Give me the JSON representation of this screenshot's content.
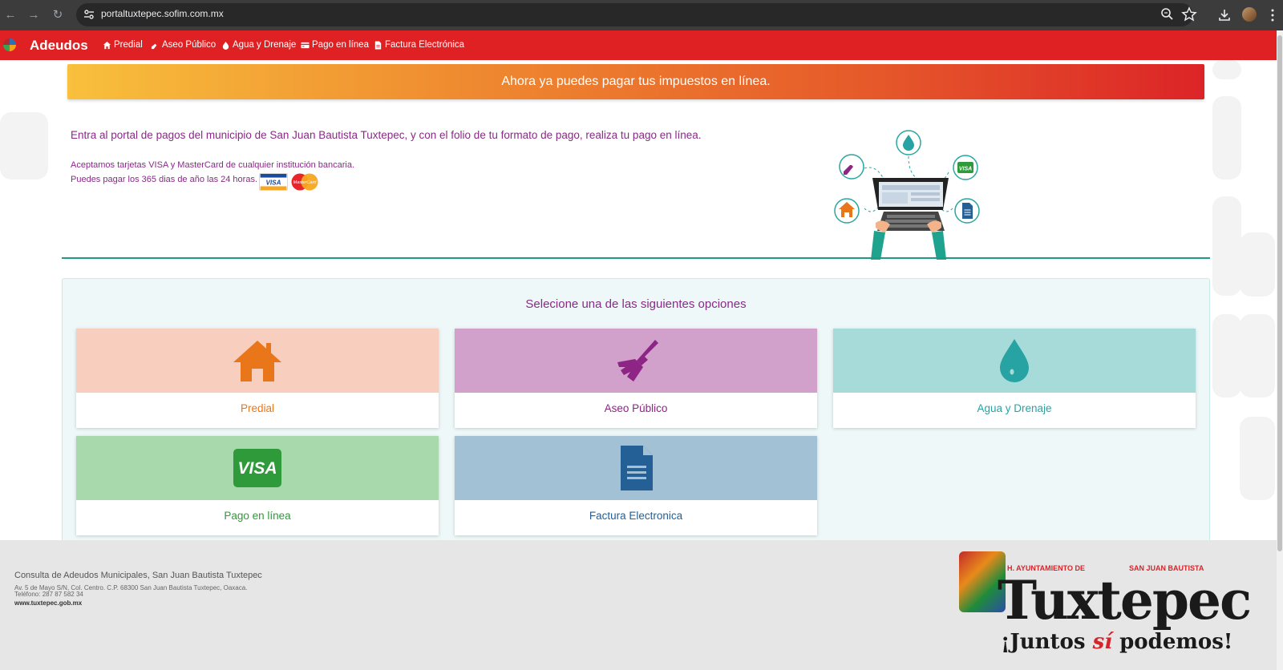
{
  "browser": {
    "url": "portaltuxtepec.sofim.com.mx",
    "icons": [
      "back-icon",
      "forward-icon",
      "reload-icon",
      "site-info-icon",
      "zoom-icon",
      "bookmark-star-icon",
      "download-icon",
      "profile-avatar",
      "menu-dots-icon"
    ]
  },
  "navbar": {
    "brand": "Adeudos",
    "items": [
      {
        "label": "Predial",
        "icon": "home-icon"
      },
      {
        "label": "Aseo Público",
        "icon": "broom-icon"
      },
      {
        "label": "Agua y Drenaje",
        "icon": "drop-icon"
      },
      {
        "label": "Pago en línea",
        "icon": "credit-card-icon"
      },
      {
        "label": "Factura Electrónica",
        "icon": "document-icon"
      }
    ],
    "color": "#e02124"
  },
  "banner": {
    "text": "Ahora ya puedes pagar tus impuestos en línea."
  },
  "intro": {
    "main": "Entra al portal de pagos del municipio de San Juan Bautista Tuxtepec, y con el folio de tu formato de pago, realiza tu pago en línea.",
    "accept": "Aceptamos tarjetas VISA y MasterCard de cualquier institución bancaria.",
    "hours": "Puedes pagar los 365 dias de año las 24 horas.",
    "visa_mini": "VISA",
    "mc_mini": "MasterCard"
  },
  "options": {
    "title": "Selecione una de las siguientes opciones",
    "items": [
      {
        "label": "Predial",
        "icon": "home-icon",
        "bg": "#f8cfbe",
        "fg": "#e97618"
      },
      {
        "label": "Aseo Público",
        "icon": "broom-icon",
        "bg": "#d1a0cb",
        "fg": "#8e2486"
      },
      {
        "label": "Agua y Drenaje",
        "icon": "drop-icon",
        "bg": "#a6dbda",
        "fg": "#27a3a3"
      },
      {
        "label": "Pago en línea",
        "icon": "visa-card-icon",
        "bg": "#a8d9ad",
        "fg": "#2e9a3a",
        "badge": "VISA"
      },
      {
        "label": "Factura Electronica",
        "icon": "document-icon",
        "bg": "#a3c1d5",
        "fg": "#245f96"
      }
    ]
  },
  "footer": {
    "title": "Consulta de Adeudos Municipales, San Juan Bautista Tuxtepec",
    "address": "Av. 5 de Mayo S/N, Col. Centro. C.P. 68300 San Juan Bautista Tuxtepec, Oaxaca.",
    "phone": "Teléfono: 287 87 582 34",
    "website": "www.tuxtepec.gob.mx",
    "logo_top_left": "H. AYUNTAMIENTO DE",
    "logo_top_right": "SAN JUAN BAUTISTA",
    "logo_big": "Tuxtepec",
    "slogan_a": "¡Juntos ",
    "slogan_b": "sí",
    "slogan_c": " podemos!"
  }
}
